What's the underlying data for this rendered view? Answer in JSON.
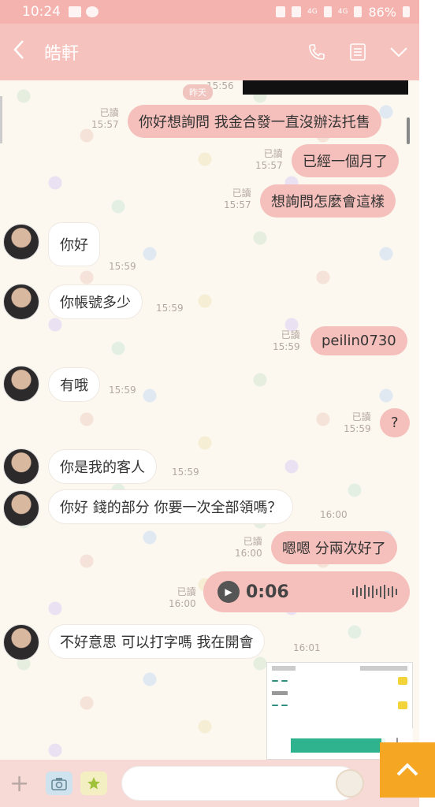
{
  "status_bar": {
    "time": "10:24",
    "signal_text_1": "4G",
    "signal_text_2": "4G",
    "battery": "86%"
  },
  "header": {
    "back_icon": "chevron-left-icon",
    "title": "皓軒",
    "actions": [
      "phone-icon",
      "notes-icon",
      "chevron-down-icon"
    ]
  },
  "chat": {
    "date_label": "昨天",
    "messages": [
      {
        "dir": "out",
        "read": "已讀",
        "time": "15:57",
        "text": "你好想詢問 我金合發一直沒辦法托售"
      },
      {
        "dir": "out",
        "read": "已讀",
        "time": "15:57",
        "text": "已經一個月了"
      },
      {
        "dir": "out",
        "read": "已讀",
        "time": "15:57",
        "text": "想詢問怎麼會這樣"
      },
      {
        "dir": "in",
        "time": "15:59",
        "text": "你好"
      },
      {
        "dir": "in",
        "time": "15:59",
        "text": "你帳號多少"
      },
      {
        "dir": "out",
        "read": "已讀",
        "time": "15:59",
        "text": "peilin0730"
      },
      {
        "dir": "in",
        "time": "15:59",
        "text": "有哦"
      },
      {
        "dir": "out",
        "read": "已讀",
        "time": "15:59",
        "text": "?"
      },
      {
        "dir": "in",
        "time": "15:59",
        "text": "你是我的客人"
      },
      {
        "dir": "in",
        "time": "16:00",
        "text": "你好 錢的部分 你要一次全部領嗎？"
      },
      {
        "dir": "out",
        "read": "已讀",
        "time": "16:00",
        "text": "嗯嗯 分兩次好了"
      },
      {
        "dir": "out",
        "read": "已讀",
        "time": "16:00",
        "voice_duration": "0:06"
      },
      {
        "dir": "in",
        "time": "16:01",
        "text": "不好意思 可以打字嗎 我在開會"
      }
    ],
    "top_partial_time": "15:56"
  },
  "bottom_bar": {
    "plus_icon": "plus-icon",
    "camera_icon": "camera-icon",
    "photo_icon": "photo-icon",
    "input_placeholder": "",
    "sticker_icon": "lion-sticker-icon"
  },
  "scroll_to_top_icon": "chevron-up-icon",
  "colors": {
    "status_bar": "#f4b3ae",
    "header": "#f6c2bd",
    "outgoing_bubble": "#f5c0bb",
    "incoming_bubble": "#ffffff",
    "scroll_top_button": "#f5a623"
  }
}
